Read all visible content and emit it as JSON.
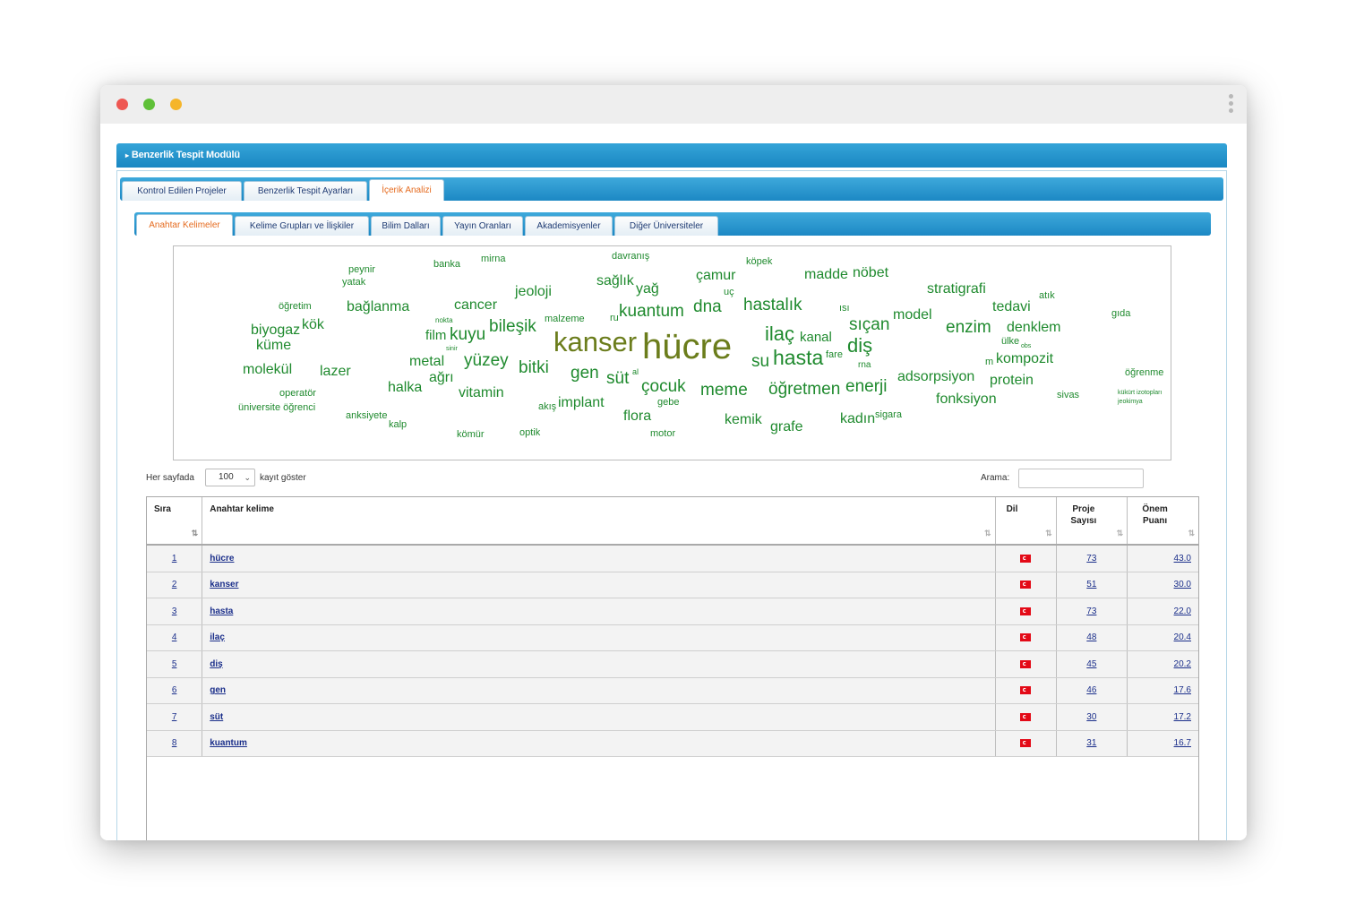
{
  "module": {
    "title": "Benzerlik Tespit Modülü"
  },
  "main_tabs": [
    {
      "label": "Kontrol Edilen Projeler"
    },
    {
      "label": "Benzerlik Tespit Ayarları"
    },
    {
      "label": "İçerik Analizi"
    }
  ],
  "sub_tabs": [
    {
      "label": "Anahtar Kelimeler"
    },
    {
      "label": "Kelime Grupları ve İlişkiler"
    },
    {
      "label": "Bilim Dalları"
    },
    {
      "label": "Yayın Oranları"
    },
    {
      "label": "Akademisyenler"
    },
    {
      "label": "Diğer Üniversiteler"
    }
  ],
  "colors": {
    "cloud_green": "#1f8a2e",
    "cloud_olive": "#6b7d1c",
    "tab_blue": "#1c88c4",
    "active_tab_text": "#e56b1f",
    "link": "#1a2e8a"
  },
  "word_cloud": [
    {
      "text": "peynir"
    },
    {
      "text": "yatak"
    },
    {
      "text": "banka"
    },
    {
      "text": "mirna"
    },
    {
      "text": "davranış"
    },
    {
      "text": "köpek"
    },
    {
      "text": "sağlık"
    },
    {
      "text": "çamur"
    },
    {
      "text": "madde"
    },
    {
      "text": "nöbet"
    },
    {
      "text": "jeoloji"
    },
    {
      "text": "yağ"
    },
    {
      "text": "stratigrafi"
    },
    {
      "text": "uç"
    },
    {
      "text": "atık"
    },
    {
      "text": "öğretim"
    },
    {
      "text": "bağlanma"
    },
    {
      "text": "cancer"
    },
    {
      "text": "hastalık"
    },
    {
      "text": "tedavi"
    },
    {
      "text": "kuantum"
    },
    {
      "text": "dna"
    },
    {
      "text": "ısı"
    },
    {
      "text": "model"
    },
    {
      "text": "gıda"
    },
    {
      "text": "nokta"
    },
    {
      "text": "malzeme"
    },
    {
      "text": "ru"
    },
    {
      "text": "biyogaz"
    },
    {
      "text": "kök"
    },
    {
      "text": "bileşik"
    },
    {
      "text": "sıçan"
    },
    {
      "text": "enzim"
    },
    {
      "text": "denklem"
    },
    {
      "text": "film"
    },
    {
      "text": "kuyu"
    },
    {
      "text": "kanser"
    },
    {
      "text": "hücre"
    },
    {
      "text": "ilaç"
    },
    {
      "text": "kanal"
    },
    {
      "text": "küme"
    },
    {
      "text": "sinir"
    },
    {
      "text": "diş"
    },
    {
      "text": "ülke"
    },
    {
      "text": "obs"
    },
    {
      "text": "metal"
    },
    {
      "text": "yüzey"
    },
    {
      "text": "su"
    },
    {
      "text": "hasta"
    },
    {
      "text": "fare"
    },
    {
      "text": "kompozit"
    },
    {
      "text": "molekül"
    },
    {
      "text": "lazer"
    },
    {
      "text": "bitki"
    },
    {
      "text": "gen"
    },
    {
      "text": "rna"
    },
    {
      "text": "m"
    },
    {
      "text": "öğrenme"
    },
    {
      "text": "ağrı"
    },
    {
      "text": "süt"
    },
    {
      "text": "al"
    },
    {
      "text": "adsorpsiyon"
    },
    {
      "text": "halka"
    },
    {
      "text": "çocuk"
    },
    {
      "text": "protein"
    },
    {
      "text": "operatör"
    },
    {
      "text": "vitamin"
    },
    {
      "text": "meme"
    },
    {
      "text": "öğretmen"
    },
    {
      "text": "enerji"
    },
    {
      "text": "kükürt izotopları"
    },
    {
      "text": "jeokimya"
    },
    {
      "text": "sivas"
    },
    {
      "text": "üniversite öğrenci"
    },
    {
      "text": "fonksiyon"
    },
    {
      "text": "akış"
    },
    {
      "text": "implant"
    },
    {
      "text": "gebe"
    },
    {
      "text": "anksiyete"
    },
    {
      "text": "flora"
    },
    {
      "text": "kemik"
    },
    {
      "text": "kadın"
    },
    {
      "text": "sigara"
    },
    {
      "text": "kalp"
    },
    {
      "text": "grafe"
    },
    {
      "text": "kömür"
    },
    {
      "text": "optik"
    },
    {
      "text": "motor"
    }
  ],
  "controls": {
    "per_page_label": "Her sayfada",
    "per_page_value": "100",
    "per_page_suffix": "kayıt göster",
    "search_label": "Arama:"
  },
  "table": {
    "headers": {
      "rank": "Sıra",
      "keyword": "Anahtar kelime",
      "lang": "Dil",
      "projects_1": "Proje",
      "projects_2": "Sayısı",
      "score_1": "Önem",
      "score_2": "Puanı"
    },
    "rows": [
      {
        "rank": "1",
        "keyword": "hücre",
        "projects": "73",
        "score": "43.0"
      },
      {
        "rank": "2",
        "keyword": "kanser",
        "projects": "51",
        "score": "30.0"
      },
      {
        "rank": "3",
        "keyword": "hasta",
        "projects": "73",
        "score": "22.0"
      },
      {
        "rank": "4",
        "keyword": "ilaç",
        "projects": "48",
        "score": "20.4"
      },
      {
        "rank": "5",
        "keyword": "diş",
        "projects": "45",
        "score": "20.2"
      },
      {
        "rank": "6",
        "keyword": "gen",
        "projects": "46",
        "score": "17.6"
      },
      {
        "rank": "7",
        "keyword": "süt",
        "projects": "30",
        "score": "17.2"
      },
      {
        "rank": "8",
        "keyword": "kuantum",
        "projects": "31",
        "score": "16.7"
      }
    ]
  }
}
